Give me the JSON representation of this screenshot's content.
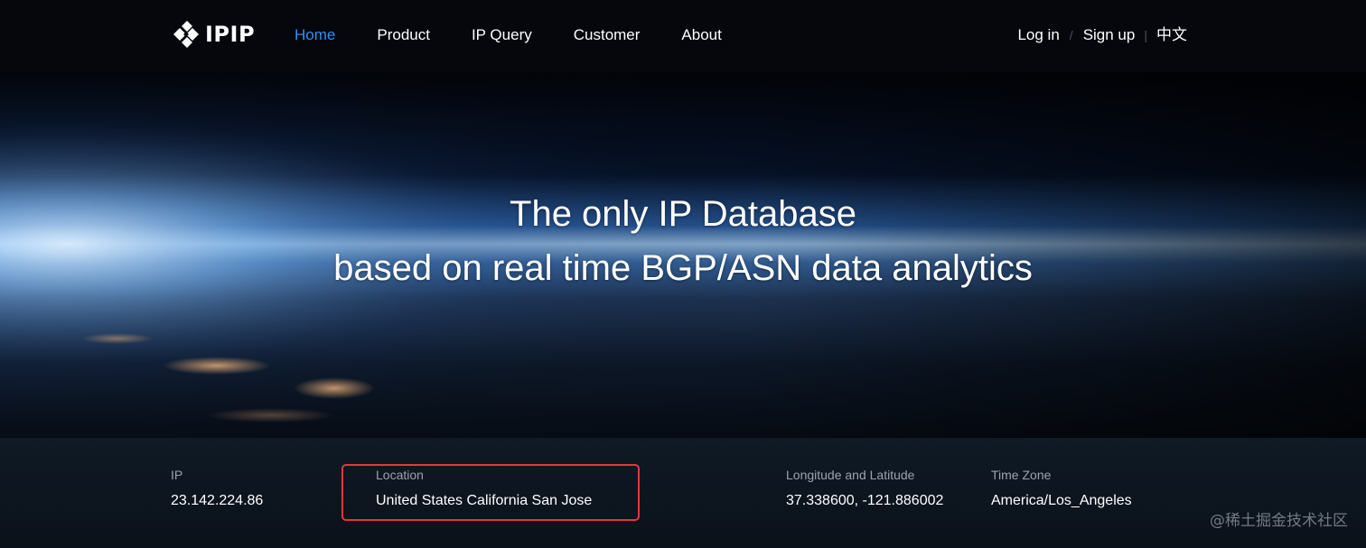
{
  "brand": {
    "name": "IPIP"
  },
  "nav": {
    "items": [
      {
        "label": "Home",
        "active": true
      },
      {
        "label": "Product",
        "active": false
      },
      {
        "label": "IP Query",
        "active": false
      },
      {
        "label": "Customer",
        "active": false
      },
      {
        "label": "About",
        "active": false
      }
    ],
    "login_label": "Log in",
    "login_separator": "/",
    "signup_label": "Sign up",
    "lang_separator": "|",
    "language_label": "中文"
  },
  "hero": {
    "title_line1": "The only IP Database",
    "title_line2": "based on real time BGP/ASN data analytics"
  },
  "info": {
    "ip_label": "IP",
    "ip_value": "23.142.224.86",
    "location_label": "Location",
    "location_value": "United States California San Jose",
    "coords_label": "Longitude and Latitude",
    "coords_value": "37.338600, -121.886002",
    "timezone_label": "Time Zone",
    "timezone_value": "America/Los_Angeles"
  },
  "watermark": "@稀土掘金技术社区",
  "colors": {
    "active_nav": "#2f8ff7",
    "highlight_border": "#e2393c",
    "navbar_bg": "#05070c",
    "info_bar_bg": "#0f1a25"
  },
  "icons": {
    "logo": "ipip-diamond-logo-icon"
  }
}
